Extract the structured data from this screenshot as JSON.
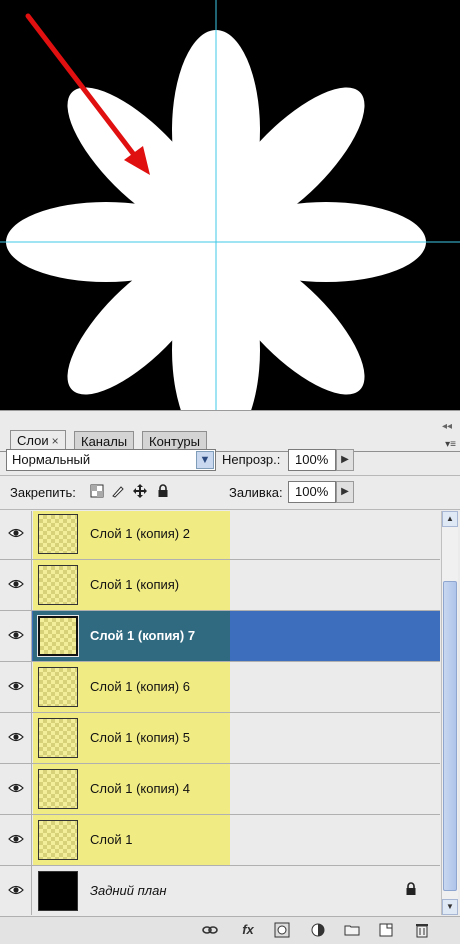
{
  "panel": {
    "tabs": [
      {
        "label": "Слои",
        "close": "×",
        "active": true
      },
      {
        "label": "Каналы",
        "active": false
      },
      {
        "label": "Контуры",
        "active": false
      }
    ],
    "panel_close": "◂◂",
    "panel_menu": "▾≡"
  },
  "blend_mode": {
    "value": "Нормальный",
    "arrow": "▼"
  },
  "opacity": {
    "label": "Непрозр.:",
    "value": "100%",
    "arrow": "▶"
  },
  "lock": {
    "label": "Закрепить:",
    "icons": [
      "lock-transparent-icon",
      "lock-paint-icon",
      "lock-move-icon",
      "lock-all-icon"
    ]
  },
  "fill": {
    "label": "Заливка:",
    "value": "100%",
    "arrow": "▶"
  },
  "layers": [
    {
      "name": "Слой 1 (копия) 2",
      "selected": false,
      "visible": true
    },
    {
      "name": "Слой 1 (копия)",
      "selected": false,
      "visible": true
    },
    {
      "name": "Слой 1 (копия) 7",
      "selected": true,
      "visible": true
    },
    {
      "name": "Слой 1 (копия) 6",
      "selected": false,
      "visible": true
    },
    {
      "name": "Слой 1 (копия) 5",
      "selected": false,
      "visible": true
    },
    {
      "name": "Слой 1 (копия) 4",
      "selected": false,
      "visible": true
    },
    {
      "name": "Слой 1",
      "selected": false,
      "visible": true
    },
    {
      "name": "Задний план",
      "selected": false,
      "visible": true,
      "background": true,
      "locked": true
    }
  ],
  "bottom_icons": [
    "link-icon",
    "fx-icon",
    "mask-icon",
    "adjustment-icon",
    "folder-icon",
    "new-layer-icon",
    "trash-icon"
  ],
  "colors": {
    "highlight": "#f1eb84",
    "selected": "#3d6ebe",
    "guide": "#3ec8e6",
    "arrow": "#e01010"
  }
}
